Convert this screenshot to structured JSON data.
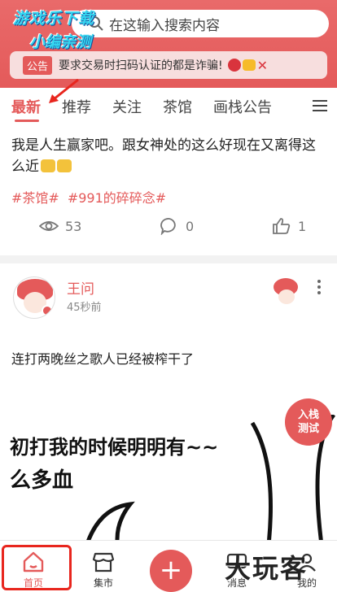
{
  "header": {
    "watermark_line1": "游戏乐下载",
    "watermark_line2": "小编亲测",
    "search_placeholder": "在这输入搜索内容",
    "notice_tag": "公告",
    "notice_text": "要求交易时扫码认证的都是诈骗!",
    "colors": {
      "accent": "#e45a5a",
      "watermark": "#34d6f0"
    }
  },
  "tabs": [
    {
      "label": "最新",
      "active": true
    },
    {
      "label": "推荐",
      "active": false
    },
    {
      "label": "关注",
      "active": false
    },
    {
      "label": "茶馆",
      "active": false
    },
    {
      "label": "画栈公告",
      "active": false
    }
  ],
  "post1": {
    "text": "我是人生赢家吧。跟女神处的这么好现在又离得这么近",
    "tags": [
      "#茶馆#",
      "#991的碎碎念#"
    ],
    "views": "53",
    "comments": "0",
    "likes": "1"
  },
  "post2": {
    "username": "王问",
    "time": "45秒前",
    "text": "连打两晚丝之歌人已经被榨干了",
    "meme_line1": "初打我的时候明明有~~",
    "meme_line2": "么多血"
  },
  "float_button": {
    "line1": "入栈",
    "line2": "测试"
  },
  "bottom_nav": [
    {
      "label": "首页",
      "icon": "home-icon",
      "active": true
    },
    {
      "label": "集市",
      "icon": "shop-icon",
      "active": false
    },
    {
      "label": "消息",
      "icon": "message-icon",
      "active": false
    },
    {
      "label": "我的",
      "icon": "user-icon",
      "active": false
    }
  ],
  "brand_watermark": "大玩客"
}
